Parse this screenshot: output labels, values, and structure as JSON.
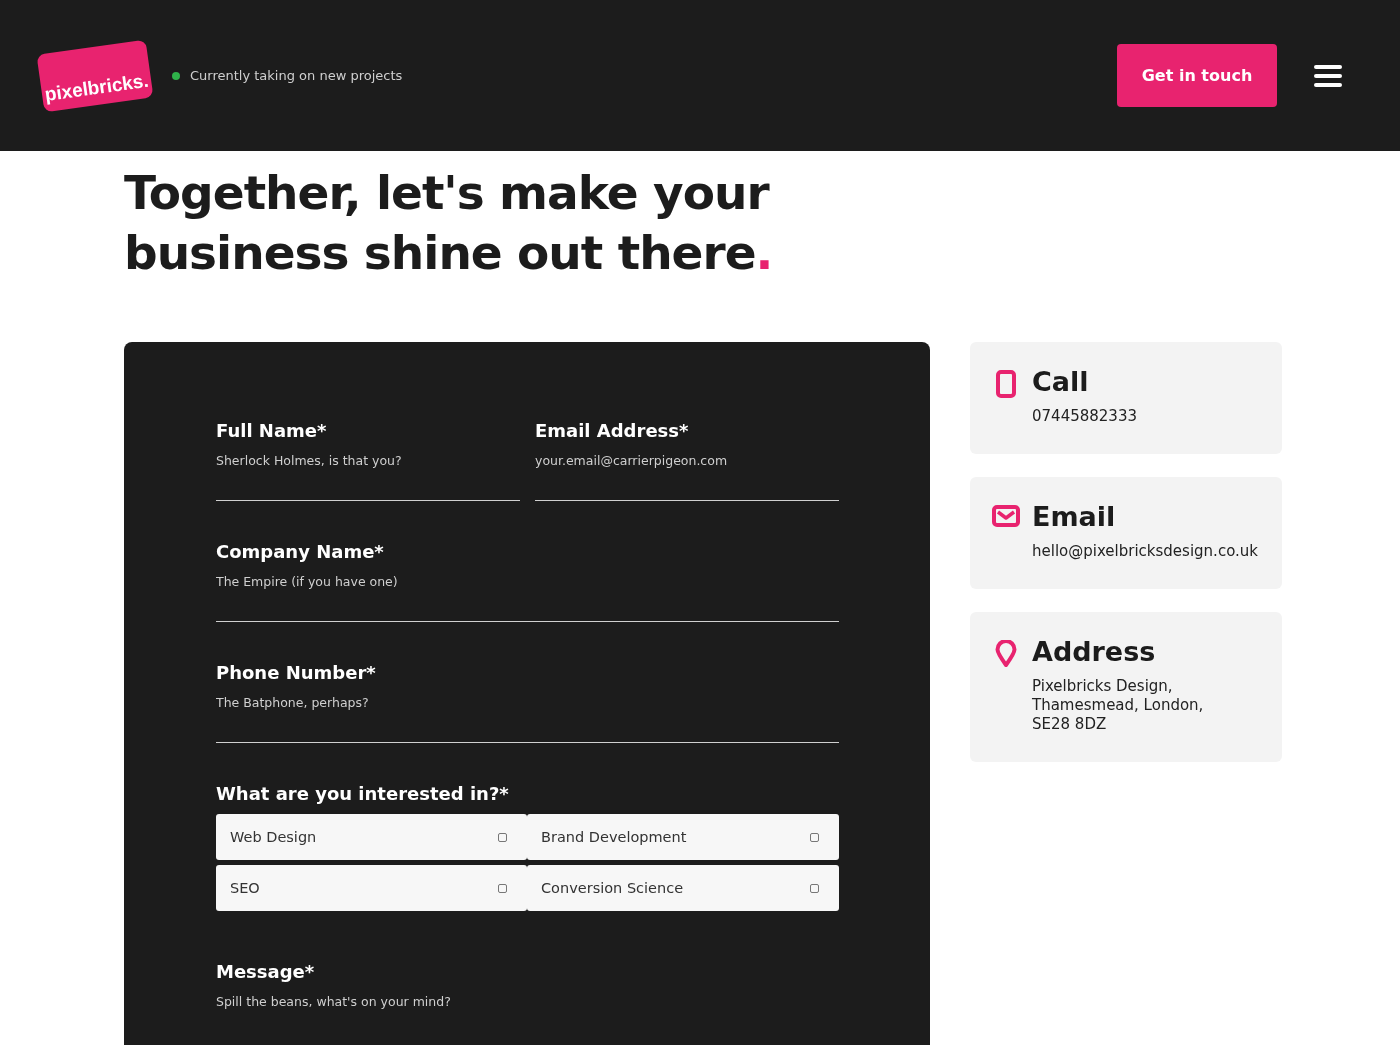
{
  "header": {
    "logo": "pixelbricks.",
    "status": {
      "text": "Currently taking on new projects",
      "color": "#2fb24a"
    },
    "cta": "Get in touch"
  },
  "heading": {
    "text": "Together, let's make your business shine out there",
    "accent": "."
  },
  "form": {
    "rows": [
      {
        "fields": [
          {
            "label": "Full Name*",
            "placeholder": "Sherlock Holmes, is that you?"
          },
          {
            "label": "Email Address*",
            "placeholder": "your.email@carrierpigeon.com"
          }
        ]
      },
      {
        "fields": [
          {
            "label": "Company Name*",
            "placeholder": "The Empire (if you have one)"
          }
        ]
      },
      {
        "fields": [
          {
            "label": "Phone Number*",
            "placeholder": "The Batphone, perhaps?"
          }
        ]
      }
    ],
    "interests": {
      "label": "What are you interested in?*",
      "options": [
        {
          "label": "Web Design",
          "checked": false
        },
        {
          "label": "Brand Development",
          "checked": false
        },
        {
          "label": "SEO",
          "checked": false
        },
        {
          "label": "Conversion Science",
          "checked": false
        }
      ]
    },
    "message": {
      "label": "Message*",
      "placeholder": "Spill the beans, what's on your mind?"
    }
  },
  "contacts": [
    {
      "kind": "phone",
      "title": "Call",
      "lines": [
        "07445882333"
      ]
    },
    {
      "kind": "email",
      "title": "Email",
      "lines": [
        "hello@pixelbricksdesign.co.uk"
      ]
    },
    {
      "kind": "address",
      "title": "Address",
      "lines": [
        "Pixelbricks Design,",
        "Thamesmead, London,",
        "SE28 8DZ"
      ]
    }
  ]
}
